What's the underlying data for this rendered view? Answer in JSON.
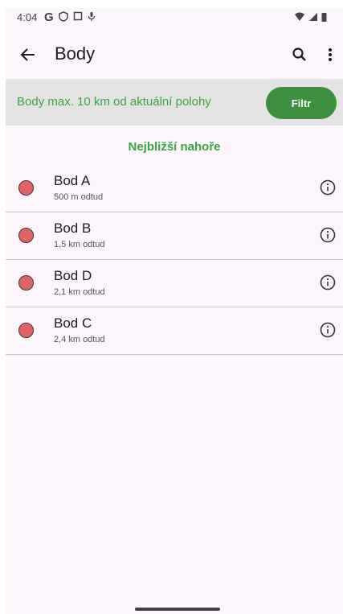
{
  "status_bar": {
    "time": "4:04",
    "icons_left": [
      "google-icon",
      "shield-icon",
      "screen-icon",
      "mic-icon"
    ],
    "icons_right": [
      "wifi-icon",
      "signal-icon",
      "battery-icon"
    ]
  },
  "app_bar": {
    "title": "Body"
  },
  "filter_banner": {
    "text": "Body max. 10 km od aktuální polohy",
    "button_label": "Filtr"
  },
  "sort_label": "Nejbližší nahoře",
  "points": [
    {
      "name": "Bod A",
      "distance": "500 m odtud"
    },
    {
      "name": "Bod B",
      "distance": "1,5 km odtud"
    },
    {
      "name": "Bod D",
      "distance": "2,1 km odtud"
    },
    {
      "name": "Bod C",
      "distance": "2,4 km odtud"
    }
  ],
  "colors": {
    "accent_green": "#3aa43f",
    "button_green": "#3b8f3f",
    "point_dot": "#e06365",
    "background": "#fcf6fc",
    "banner_bg": "#e3e3e3"
  }
}
